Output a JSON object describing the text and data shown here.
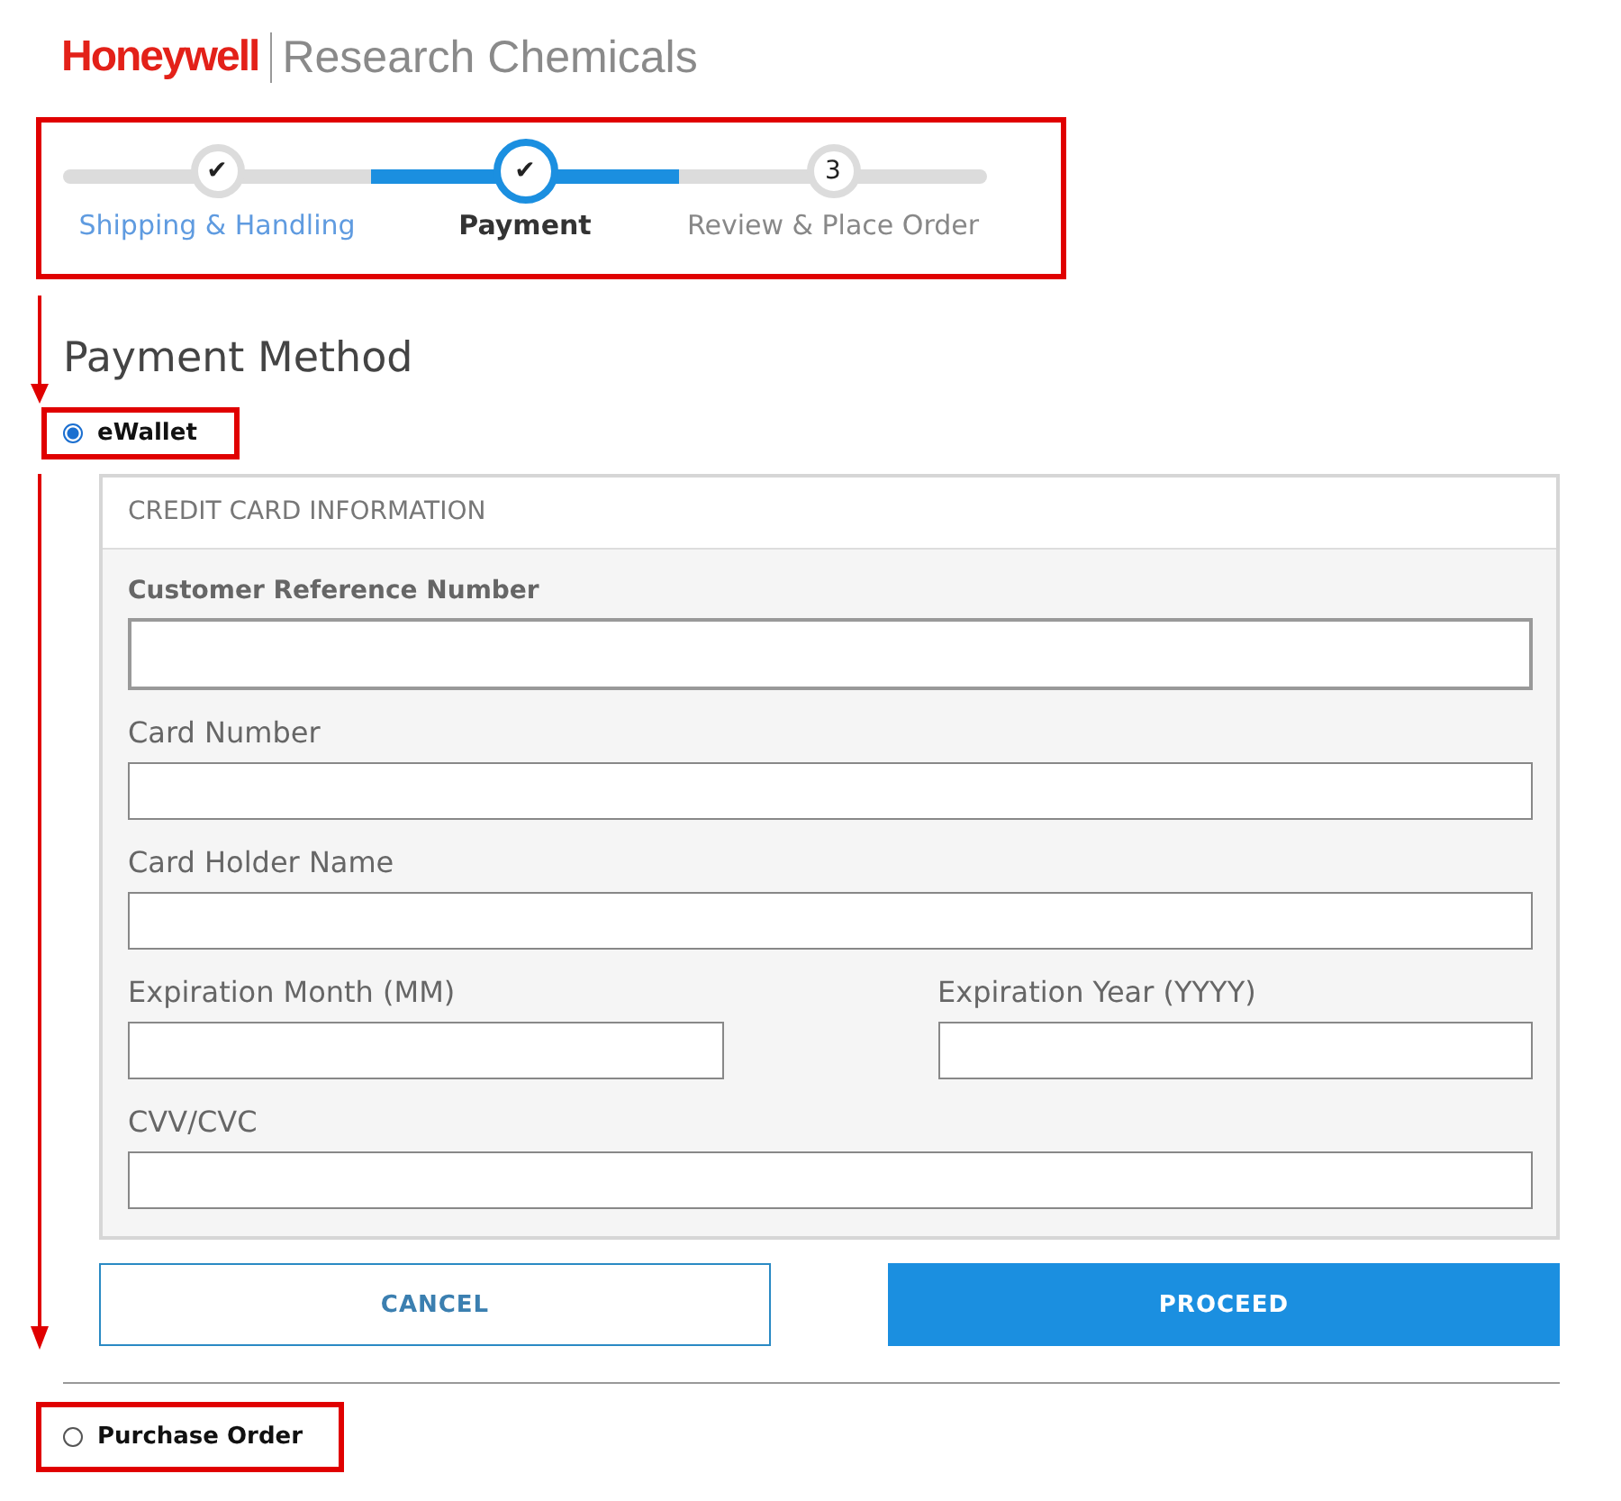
{
  "brand": {
    "logo": "Honeywell",
    "product": "Research Chemicals"
  },
  "stepper": {
    "highlighted": true,
    "steps": [
      {
        "label": "Shipping & Handling",
        "marker": "✔",
        "completed": true,
        "selected": false
      },
      {
        "label": "Payment",
        "marker": "✔",
        "completed": true,
        "selected": true
      },
      {
        "label": "Review & Place Order",
        "marker": "3",
        "completed": false,
        "selected": false
      }
    ]
  },
  "heading": "Payment Method",
  "options": [
    {
      "label": "eWallet",
      "selected": true,
      "highlighted": true
    },
    {
      "label": "Purchase Order",
      "selected": false,
      "highlighted": true
    }
  ],
  "card_panel": {
    "title": "CREDIT CARD INFORMATION",
    "fields": [
      {
        "label": "Customer Reference Number",
        "emphasized": true,
        "half": false
      },
      {
        "label": "Card Number",
        "emphasized": false,
        "half": false
      },
      {
        "label": "Card Holder Name",
        "emphasized": false,
        "half": false
      },
      {
        "label": "Expiration Month (MM)",
        "emphasized": false,
        "half": true
      },
      {
        "label": "Expiration Year (YYYY)",
        "emphasized": false,
        "half": true
      },
      {
        "label": "CVV/CVC",
        "emphasized": false,
        "half": false
      }
    ]
  },
  "buttons": [
    {
      "label": "CANCEL",
      "kind": "secondary"
    },
    {
      "label": "PROCEED",
      "kind": "primary"
    }
  ]
}
